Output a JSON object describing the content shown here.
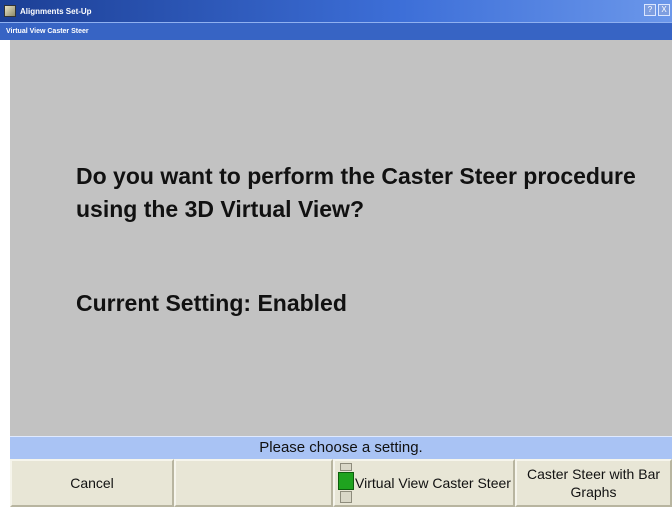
{
  "window": {
    "title": "Alignments Set-Up",
    "subtitle": "Virtual View Caster Steer",
    "controls": [
      "?",
      "X"
    ]
  },
  "main": {
    "question": "Do you want to perform the Caster Steer procedure using the 3D Virtual View?",
    "current_setting": "Current Setting: Enabled"
  },
  "status": {
    "message": "Please choose a setting."
  },
  "buttons": {
    "cancel": "Cancel",
    "empty": "",
    "virtual_view": "Virtual View Caster Steer",
    "bar_graphs": "Caster Steer with Bar Graphs"
  },
  "colors": {
    "titlebar": "#1c3f95",
    "content_bg": "#c2c2c2",
    "status_bg": "#a9c3f4",
    "button_bg": "#e8e6d6",
    "indicator_active": "#1fa31f"
  },
  "icons": {
    "app": "app-icon",
    "selected_indicator": "selected-indicator-icon"
  }
}
